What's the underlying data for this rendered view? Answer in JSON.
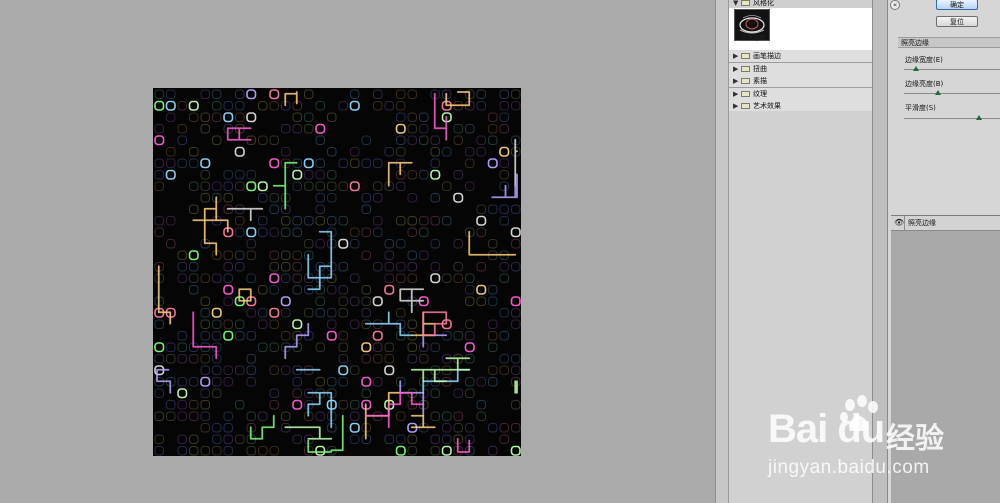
{
  "gallery": {
    "open_folder": "风格化",
    "selected_filter_thumb": "照亮边缘",
    "folders": [
      "画笔描边",
      "扭曲",
      "素描",
      "纹理",
      "艺术效果"
    ]
  },
  "buttons": {
    "ok": "确定",
    "reset": "复位"
  },
  "settings": {
    "filter_name": "照亮边缘",
    "params": [
      {
        "label": "边缘宽度(E)",
        "value": 0.12
      },
      {
        "label": "边缘亮度(B)",
        "value": 0.35
      },
      {
        "label": "平滑度(S)",
        "value": 0.78
      }
    ]
  },
  "layers": {
    "items": [
      {
        "label": "照亮边缘"
      }
    ]
  },
  "watermark": {
    "brand": "Bai du",
    "product": "经验",
    "url": "jingyan.baidu.com"
  },
  "colors": {
    "workspace_bg": "#abaaab",
    "canvas_bg": "#050506",
    "accent_green": "#1d6b3a"
  },
  "icons": [
    "collapse-icon",
    "folder-icon",
    "eye-icon",
    "baidu-paw-icon"
  ]
}
